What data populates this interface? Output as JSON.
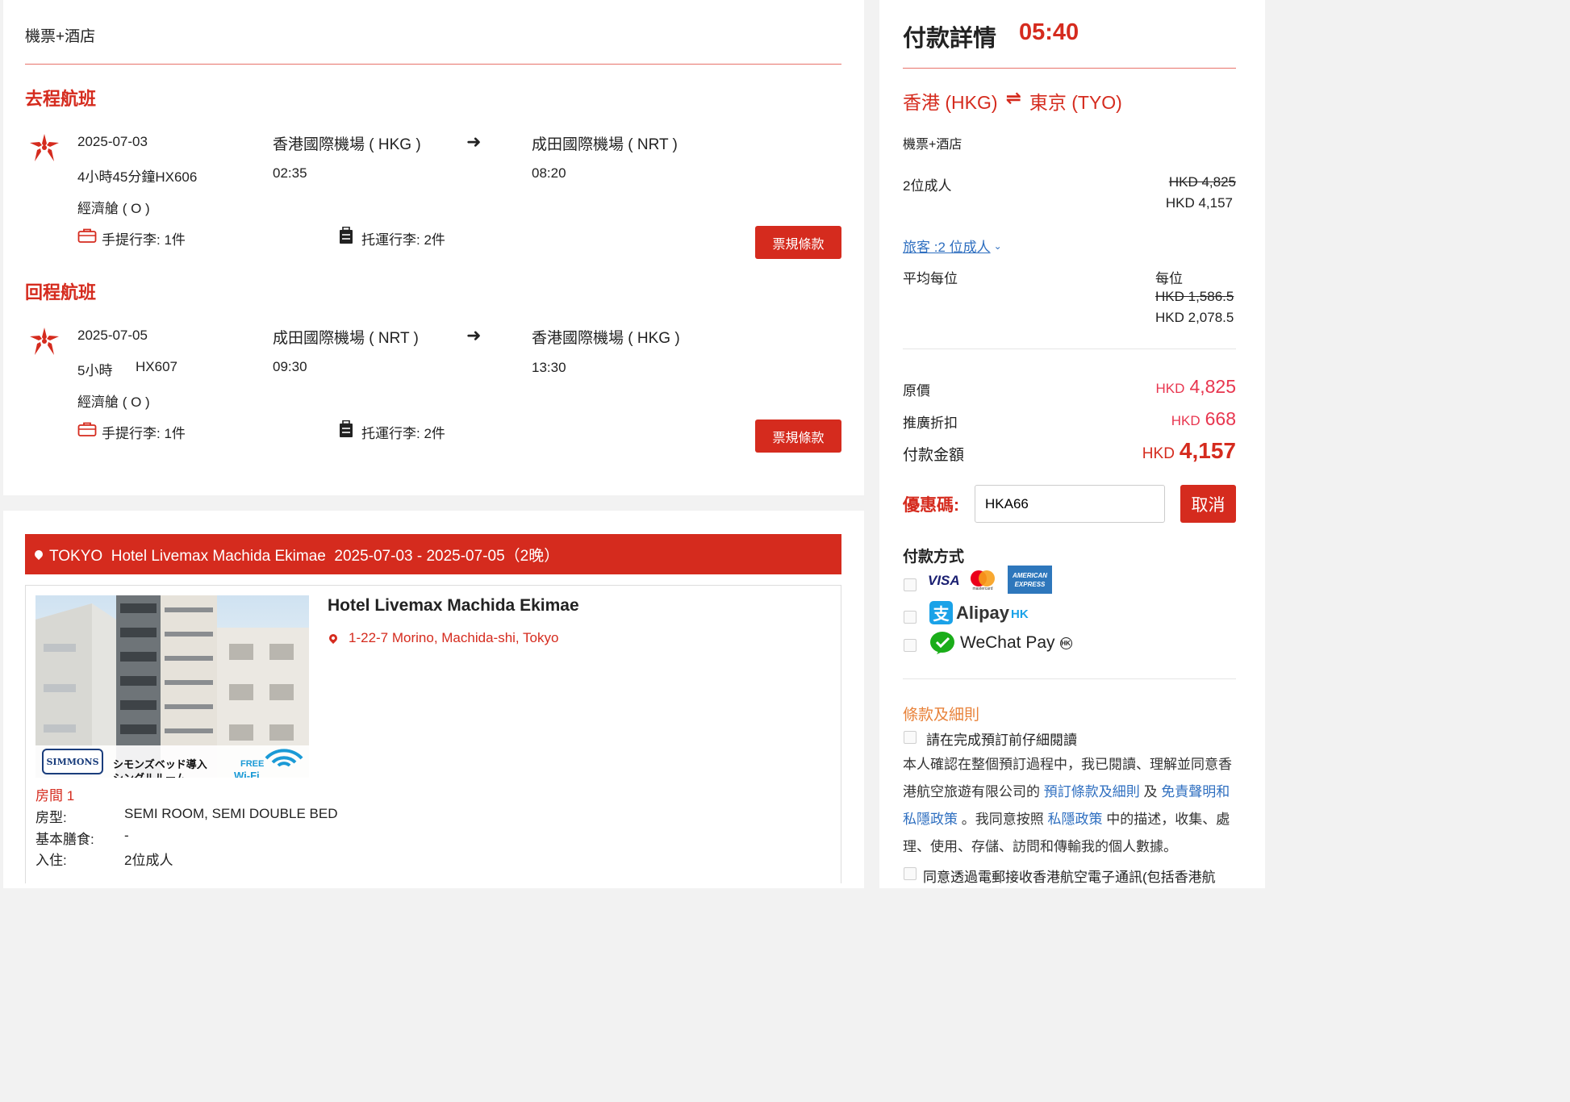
{
  "flight_card": {
    "title": "機票+酒店",
    "outbound": {
      "heading": "去程航班",
      "date": "2025-07-03",
      "duration_flight": "4小時45分鐘HX606",
      "cabin": "經濟艙 ( O )",
      "from_airport": "香港國際機場 ( HKG )",
      "depart_time": "02:35",
      "to_airport": "成田國際機場 ( NRT )",
      "arrive_time": "08:20",
      "carry_on": "手提行李: 1件",
      "checked": "托運行李: 2件",
      "rules_button": "票規條款"
    },
    "inbound": {
      "heading": "回程航班",
      "date": "2025-07-05",
      "duration": "5小時",
      "flight_no": "HX607",
      "cabin": "經濟艙 ( O )",
      "from_airport": "成田國際機場 ( NRT )",
      "depart_time": "09:30",
      "to_airport": "香港國際機場 ( HKG )",
      "arrive_time": "13:30",
      "carry_on": "手提行李: 1件",
      "checked": "托運行李: 2件",
      "rules_button": "票規條款"
    }
  },
  "hotel_card": {
    "banner": "TOKYO  Hotel Livemax Machida Ekimae  2025-07-03 - 2025-07-05（2晚）",
    "name": "Hotel Livemax Machida Ekimae",
    "address": "1-22-7 Morino, Machida-shi, Tokyo",
    "image_text": {
      "brand": "SIMMONS",
      "caption": "シモンズベッド導入",
      "caption2": "シングルルーム",
      "wifi": "FREE",
      "wifi2": "Wi-Fi"
    },
    "room_title": "房間 1",
    "room_type_label": "房型:",
    "room_type_value": "SEMI ROOM, SEMI DOUBLE BED",
    "meal_label": "基本膳食:",
    "meal_value": "-",
    "checkin_label": "入住:",
    "checkin_value": "2位成人"
  },
  "payment": {
    "title": "付款詳情",
    "timer": "05:40",
    "route_from": "香港 (HKG)",
    "route_arrow": "⇌",
    "route_to": "東京 (TYO)",
    "product": "機票+酒店",
    "adults_label": "2位成人",
    "adults_original": "HKD 4,825",
    "adults_price": "HKD 4,157",
    "travellers_link": "旅客 :2 位成人",
    "avg_label": "平均每位",
    "per_person_label": "每位",
    "avg_original": "HKD 1,586.5",
    "avg_price": "HKD 2,078.5",
    "original_label": "原價",
    "original_currency": "HKD",
    "original_value": "4,825",
    "discount_label": "推廣折扣",
    "discount_currency": "HKD",
    "discount_value": "668",
    "total_label": "付款金額",
    "total_currency": "HKD",
    "total_value": "4,157",
    "promo_label": "優惠碼:",
    "promo_value": "HKA66",
    "promo_cancel": "取消",
    "method_label": "付款方式",
    "visa": "VISA",
    "mastercard": "mastercard",
    "amex1": "AMERICAN",
    "amex2": "EXPRESS",
    "alipay": "Alipay",
    "alipay_hk": "HK",
    "wechat": "WeChat Pay",
    "wechat_hk": "HK",
    "terms_title": "條款及細則",
    "terms_check1": "請在完成預訂前仔細閱讀",
    "terms_p1": "本人確認在整個預訂過程中，我已閱讀、理解並同意香港航空旅遊有限公司的",
    "terms_link1": "預訂條款及細則",
    "terms_and": "及",
    "terms_link2": "免責聲明和私隱政策",
    "terms_p2": "。我同意按照",
    "terms_link3": "私隱政策",
    "terms_p3": "中的描述，收集、處理、使用、存儲、訪問和傳輸我的個人數據。",
    "terms_check2": "同意透過電郵接收香港航空電子通訊(包括香港航"
  },
  "colors": {
    "brand_red": "#d52b1e",
    "price_pink": "#e8364f",
    "link_blue": "#2f6fc0",
    "terms_orange": "#e8823a"
  }
}
